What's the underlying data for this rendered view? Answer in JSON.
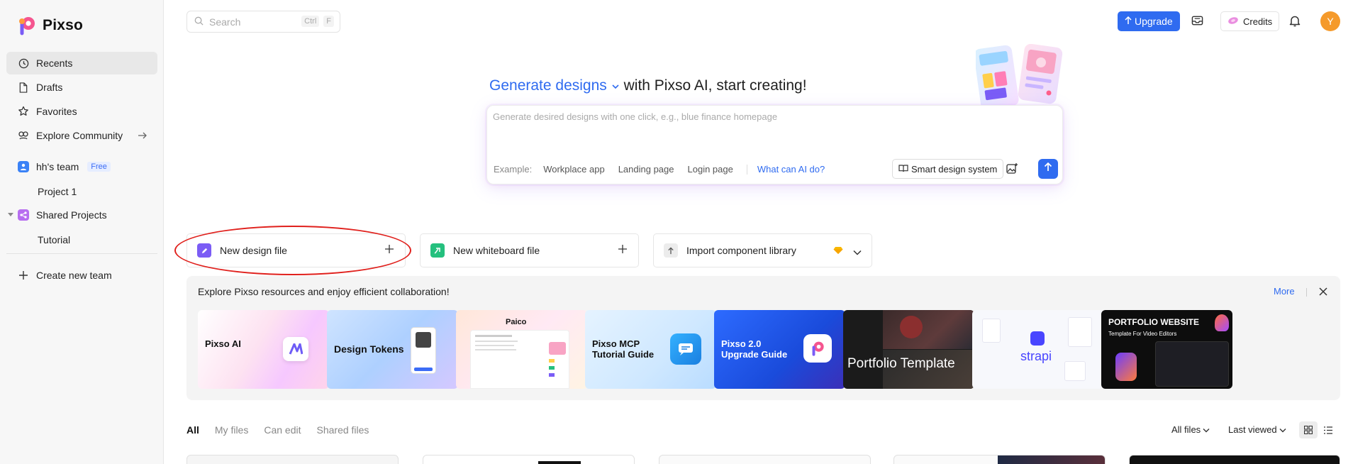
{
  "app": {
    "name": "Pixso"
  },
  "sidebar": {
    "items": [
      {
        "label": "Recents",
        "icon": "clock-icon"
      },
      {
        "label": "Drafts",
        "icon": "file-icon"
      },
      {
        "label": "Favorites",
        "icon": "star-icon"
      },
      {
        "label": "Explore Community",
        "icon": "community-icon"
      }
    ],
    "team": {
      "name": "hh's team",
      "badge": "Free",
      "project": "Project 1"
    },
    "shared": {
      "label": "Shared Projects",
      "project": "Tutorial"
    },
    "create_team": "Create new team"
  },
  "topbar": {
    "search_placeholder": "Search",
    "shortcut_keys": [
      "Ctrl",
      "F"
    ],
    "upgrade_label": "Upgrade",
    "credits_label": "Credits",
    "avatar_initial": "Y"
  },
  "hero": {
    "generate_label": "Generate designs",
    "title_suffix": "with Pixso AI, start creating!",
    "prompt_placeholder": "Generate desired designs with one click, e.g., blue finance homepage",
    "example_label": "Example:",
    "examples": [
      "Workplace app",
      "Landing page",
      "Login page"
    ],
    "what_can_ai": "What can AI do?",
    "smart_design_label": "Smart design system"
  },
  "actions": [
    {
      "label": "New design file",
      "color": "#7b5cf5"
    },
    {
      "label": "New whiteboard file",
      "color": "#25c07e"
    },
    {
      "label": "Import component library",
      "color": "#e9e9e9"
    }
  ],
  "resources": {
    "title": "Explore Pixso resources and enjoy efficient collaboration!",
    "more_label": "More",
    "tiles": [
      {
        "label": "Pixso AI"
      },
      {
        "label": "Design Tokens"
      },
      {
        "label": "Paico"
      },
      {
        "label": "Pixso MCP Tutorial Guide"
      },
      {
        "label": "Pixso 2.0 Upgrade Guide"
      },
      {
        "label": "Portfolio Template"
      },
      {
        "label": "strapi"
      },
      {
        "label": "PORTFOLIO WEBSITE",
        "sub": "Template For Video Editors"
      }
    ]
  },
  "file_tabs": {
    "tabs": [
      "All",
      "My files",
      "Can edit",
      "Shared files"
    ],
    "filter_label": "All files",
    "sort_label": "Last viewed"
  },
  "colors": {
    "accent": "#2f6bf0",
    "avatar": "#f59a2b",
    "highlight": "#e0201c"
  }
}
